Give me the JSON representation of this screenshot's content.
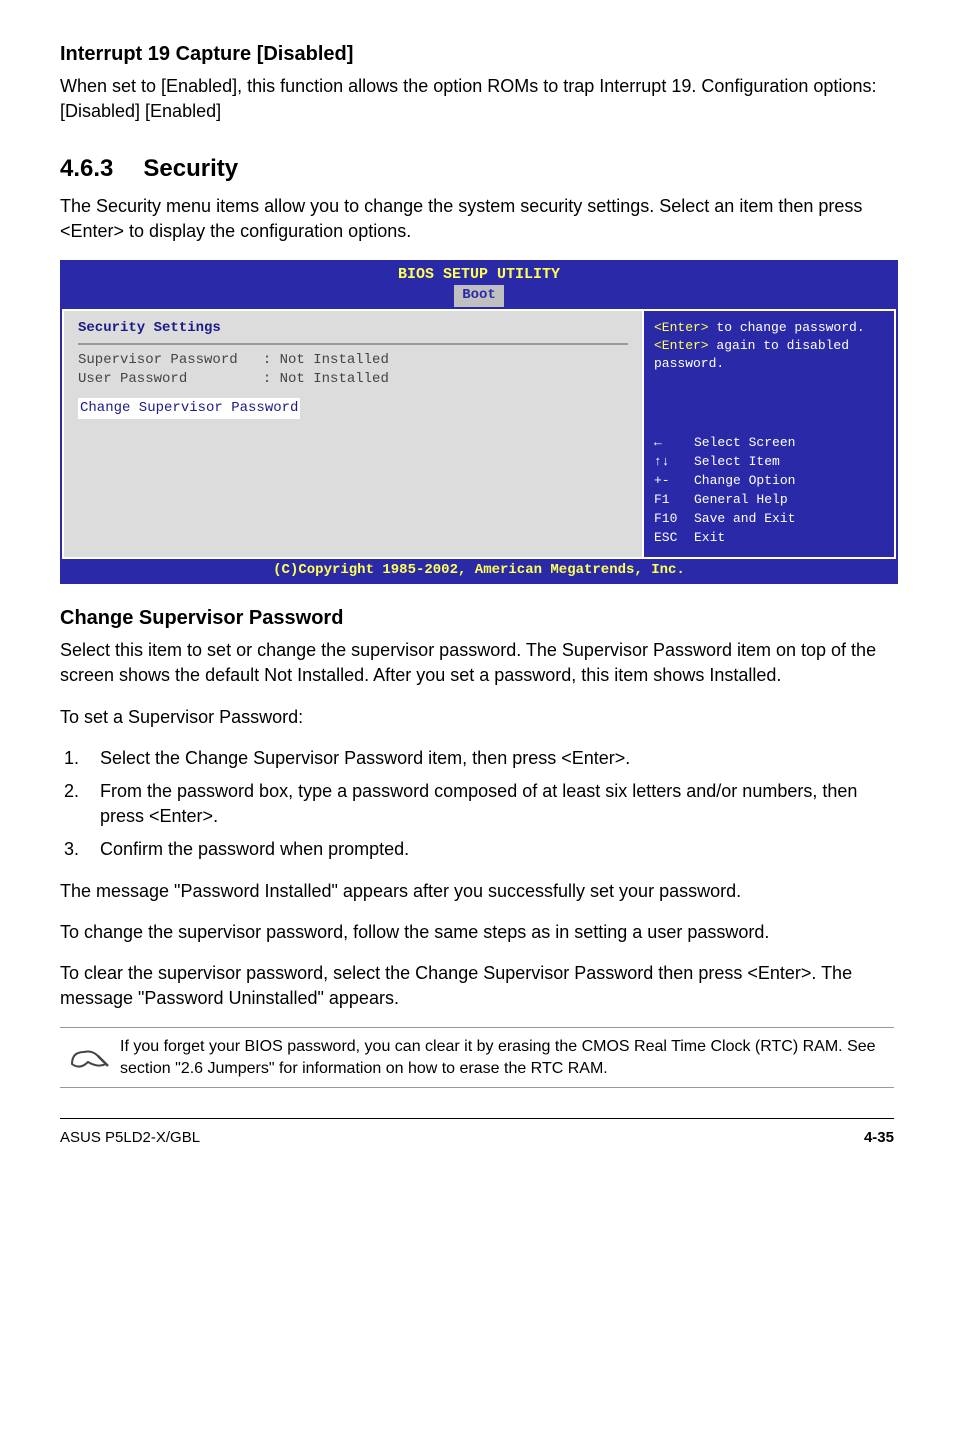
{
  "setting1": {
    "title": "Interrupt 19 Capture [Disabled]",
    "desc": "When set to [Enabled], this function allows the option ROMs to trap Interrupt 19. Configuration options: [Disabled] [Enabled]"
  },
  "section": {
    "number": "4.6.3",
    "title": "Security",
    "intro": "The Security menu items allow you to change the system security settings. Select an item then press <Enter> to display the configuration options."
  },
  "bios": {
    "header": "BIOS SETUP UTILITY",
    "tab": "Boot",
    "left": {
      "heading": "Security Settings",
      "row1": "Supervisor Password   : Not Installed",
      "row2": "User Password         : Not Installed",
      "highlight": "Change Supervisor Password"
    },
    "right": {
      "help1a": "<Enter>",
      "help1b": " to change password.",
      "help2a": "<Enter>",
      "help2b": " again to disabled password.",
      "nav": [
        {
          "key": "←",
          "label": "Select Screen"
        },
        {
          "key": "↑↓",
          "label": "Select Item"
        },
        {
          "key": "+-",
          "label": "Change Option"
        },
        {
          "key": "F1",
          "label": "General Help"
        },
        {
          "key": "F10",
          "label": "Save and Exit"
        },
        {
          "key": "ESC",
          "label": "Exit"
        }
      ]
    },
    "footer": "(C)Copyright 1985-2002, American Megatrends, Inc."
  },
  "changepw": {
    "title": "Change Supervisor Password",
    "p1": "Select this item to set or change the supervisor password. The Supervisor Password item on top of the screen shows the default Not Installed. After you set a password, this item shows Installed.",
    "p2": "To set a Supervisor Password:",
    "steps": [
      "Select the Change Supervisor Password item, then press <Enter>.",
      "From the password box, type a password composed of at least six letters and/or numbers, then press <Enter>.",
      "Confirm the password when prompted."
    ],
    "p3": "The message \"Password Installed\" appears after you successfully set your password.",
    "p4": "To change the supervisor password, follow the same steps as in setting a user password.",
    "p5": "To clear the supervisor password, select the Change Supervisor Password then press <Enter>. The message \"Password Uninstalled\" appears."
  },
  "note": "If you forget your BIOS password, you can clear it by erasing the CMOS Real Time Clock (RTC) RAM. See section \"2.6  Jumpers\" for information on how to erase the RTC RAM.",
  "footer": {
    "left": "ASUS P5LD2-X/GBL",
    "right": "4-35"
  }
}
